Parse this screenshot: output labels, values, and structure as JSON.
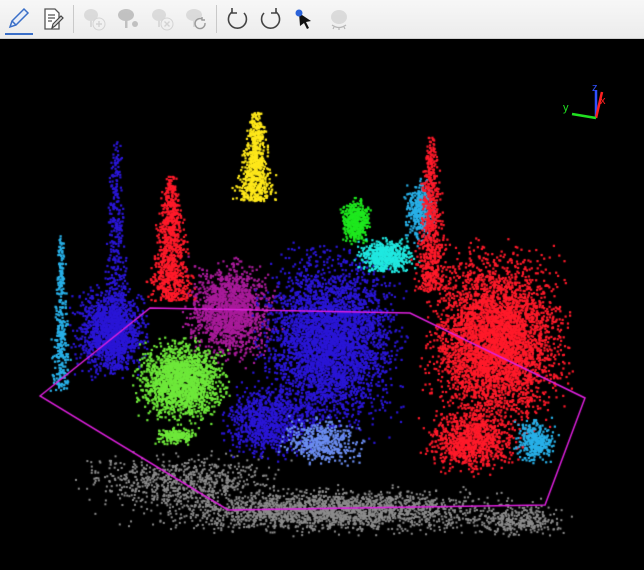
{
  "toolbar": {
    "buttons": [
      {
        "id": "draw",
        "icon": "pencil-icon",
        "active": true,
        "enabled": true
      },
      {
        "id": "edit",
        "icon": "edit-document-icon",
        "enabled": true
      },
      {
        "id": "add-tree",
        "icon": "add-tree-icon",
        "enabled": false
      },
      {
        "id": "split-tree",
        "icon": "split-tree-icon",
        "enabled": false
      },
      {
        "id": "delete-tree",
        "icon": "delete-tree-icon",
        "enabled": false
      },
      {
        "id": "refresh-tree",
        "icon": "refresh-tree-icon",
        "enabled": false
      },
      {
        "id": "undo",
        "icon": "undo-icon",
        "enabled": true
      },
      {
        "id": "redo",
        "icon": "redo-icon",
        "enabled": true
      },
      {
        "id": "pick",
        "icon": "pick-point-icon",
        "enabled": true
      },
      {
        "id": "hide-tree",
        "icon": "hidden-tree-icon",
        "enabled": false
      }
    ]
  },
  "axes": {
    "x": "x",
    "y": "y",
    "z": "z",
    "x_color": "#ff2020",
    "y_color": "#20e020",
    "z_color": "#3050ff"
  },
  "colors": {
    "background": "#000000",
    "ground": "#8c8c8c",
    "selection_polygon": "#e020e0",
    "trees": [
      "#2a16d6",
      "#ff1a2a",
      "#28b0e8",
      "#ffe81a",
      "#a81b9a",
      "#6ee83a",
      "#1ee81e",
      "#20e8e0",
      "#6a8cf0"
    ]
  }
}
